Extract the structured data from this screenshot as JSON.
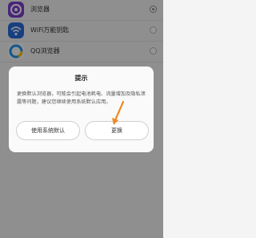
{
  "apps": [
    {
      "name": "浏览器",
      "selected": true,
      "icon": "browser-icon",
      "color": "#7b3fd0"
    },
    {
      "name": "WiFi万能钥匙",
      "selected": false,
      "icon": "wifi-key-icon",
      "color": "#2a6de0"
    },
    {
      "name": "QQ浏览器",
      "selected": false,
      "icon": "qq-browser-icon",
      "color": "#2196f3"
    }
  ],
  "dialog": {
    "title": "提示",
    "message": "更换默认浏览器，可能会引起电池耗电、流量增加及隐私泄露等问题，建议您继续使用系统默认应用。",
    "keep_default_label": "使用系统默认",
    "change_label": "更换"
  },
  "accent_color": "#f08a24"
}
